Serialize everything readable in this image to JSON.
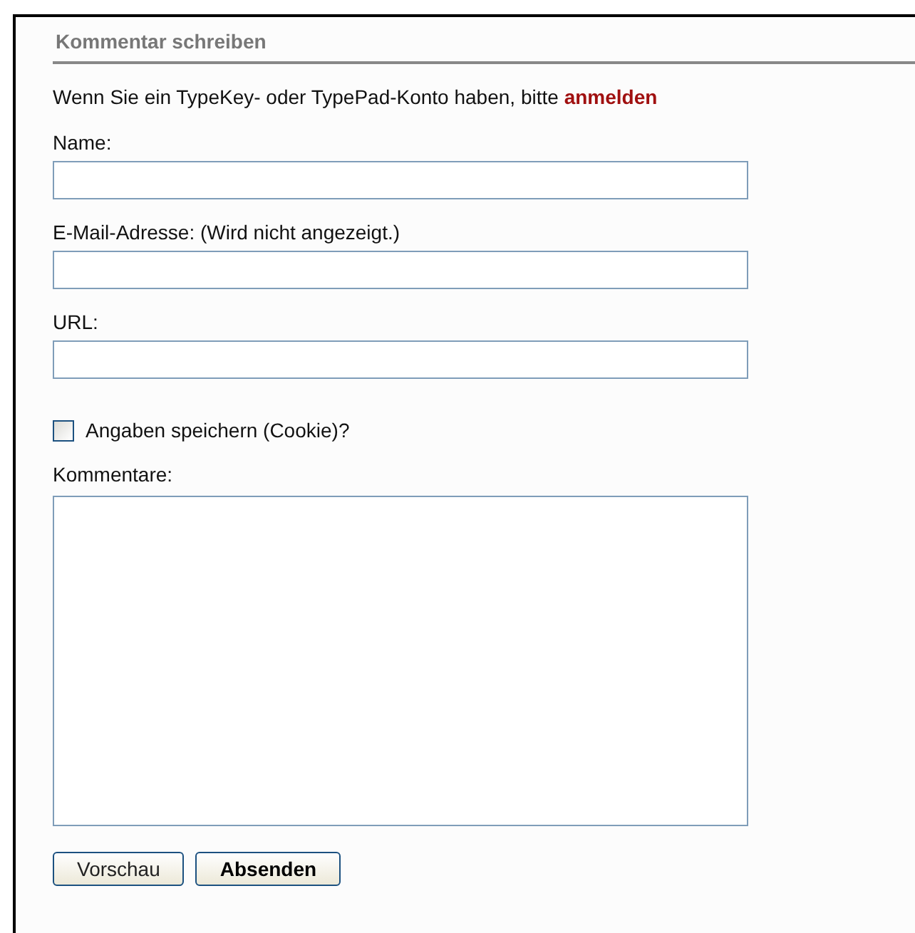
{
  "heading": "Kommentar schreiben",
  "intro": {
    "text": "Wenn Sie ein TypeKey- oder TypePad-Konto haben, bitte",
    "link": "anmelden"
  },
  "fields": [
    {
      "kind": "input",
      "label": "Name:"
    },
    {
      "kind": "input",
      "label": "E-Mail-Adresse: (Wird nicht angezeigt.)"
    },
    {
      "kind": "input",
      "label": "URL:"
    },
    {
      "kind": "checkbox",
      "label": "Angaben speichern (Cookie)?",
      "checked": false
    },
    {
      "kind": "textarea",
      "label": "Kommentare:"
    }
  ],
  "buttons": [
    {
      "label": "Vorschau",
      "kind": "normal"
    },
    {
      "label": "Absenden",
      "kind": "primary"
    }
  ]
}
